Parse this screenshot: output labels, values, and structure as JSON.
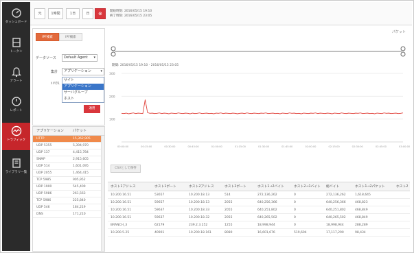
{
  "nav": {
    "items": [
      {
        "label": "ダッシュボード",
        "icon": "dashboard-icon"
      },
      {
        "label": "トークン",
        "icon": "server-icon"
      },
      {
        "label": "アラート",
        "icon": "bell-icon"
      },
      {
        "label": "レポート",
        "icon": "gauge-icon"
      },
      {
        "label": "トラフィック",
        "icon": "traffic-icon",
        "active": true
      },
      {
        "label": "ライブラリ一覧",
        "icon": "book-icon"
      }
    ]
  },
  "toolbar": {
    "buttons": [
      "元",
      "1時間",
      "1日",
      "日"
    ],
    "active_button": "⊗",
    "time_start": "開始時刻: 2016/05/15 19:10",
    "time_end": "終了時刻: 2016/05/15 23:05"
  },
  "filter": {
    "tabs": [
      "IPF検索",
      "IPF検索"
    ],
    "datasource_label": "データソース",
    "datasource_value": "Default Agent",
    "group_label": "集計",
    "group_value": "アプリケーション",
    "third_label": "ﾒﾄﾘｸｽ",
    "dropdown_options": [
      "サイト",
      "アプリケーション",
      "サーバグループ",
      "ホスト"
    ],
    "dropdown_selected": 1,
    "apply_label": "適用"
  },
  "app_table": {
    "columns": [
      "アプリケーション",
      "パケット"
    ],
    "rows": [
      [
        "HTTP",
        "15,362,905"
      ],
      [
        "UDP 5355",
        "5,394,970"
      ],
      [
        "UDP 137",
        "4,415,784"
      ],
      [
        "SNMP",
        "2,915,605"
      ],
      [
        "UDP 514",
        "1,601,095"
      ],
      [
        "UDP 2055",
        "1,464,415"
      ],
      [
        "TCP 5985",
        "905,952"
      ],
      [
        "UDP 1900",
        "545,409"
      ],
      [
        "UDP 5986",
        "261,563"
      ],
      [
        "TCP 5986",
        "225,840"
      ],
      [
        "UDP 546",
        "184,219"
      ],
      [
        "DNS",
        "171,210"
      ]
    ],
    "highlight_row": 0
  },
  "chart": {
    "right_label": "パケット",
    "range_label": "期間: 2016/05/15 19:10 - 2016/05/15 23:05",
    "export_label": "CSVとして保存"
  },
  "chart_data": {
    "type": "line",
    "title": "",
    "xlabel": "",
    "ylabel": "",
    "ylim": [
      0,
      300
    ],
    "yticks": [
      300,
      200,
      100
    ],
    "xticks": [
      "00:00:00",
      "00:15:00",
      "00:30:00",
      "00:45:00",
      "01:00:00",
      "01:15:00",
      "01:30:00",
      "01:45:00",
      "02:00:00",
      "02:15:00",
      "02:30:00",
      "02:45:00",
      "03:00:00"
    ],
    "series": [
      {
        "values": [
          125,
          124,
          126,
          123,
          125,
          127,
          124,
          126,
          125,
          124,
          185,
          128,
          125,
          126,
          124,
          125,
          127,
          124,
          126,
          125,
          123,
          126,
          125,
          124,
          127,
          125,
          124,
          126,
          125,
          123,
          126,
          124,
          125,
          127,
          124,
          125,
          126,
          124,
          125,
          123,
          126,
          125,
          127,
          124,
          126,
          125,
          124,
          126,
          125,
          123,
          125,
          126,
          124,
          127,
          125,
          124,
          126,
          125,
          124,
          126,
          125,
          127,
          124,
          125,
          126,
          124,
          125,
          123,
          126,
          125,
          124,
          127,
          125,
          126,
          124,
          125,
          123,
          126,
          125,
          124,
          126,
          125,
          127,
          124,
          126,
          125,
          124,
          126,
          125,
          123,
          126,
          125,
          124,
          127,
          125,
          124,
          126,
          125,
          124,
          126,
          125,
          127,
          124,
          125,
          126,
          124,
          125,
          123,
          126,
          125,
          124,
          127,
          125,
          126,
          124,
          125,
          126,
          124,
          125,
          127
        ]
      }
    ]
  },
  "data_table": {
    "columns": [
      "ホスト1アドレス",
      "ホスト1ポート",
      "ホスト2アドレス",
      "ホスト2ポート",
      "ホスト1→2バイト",
      "ホスト2→1バイト",
      "総バイト",
      "ホスト1→2パケット",
      "ホスト2"
    ],
    "rows": [
      [
        "10.200.16.51",
        "53657",
        "10.200.18.13",
        "514",
        "272,136,262",
        "0",
        "272,136,262",
        "1,618,645"
      ],
      [
        "10.200.16.51",
        "59657",
        "10.200.18.13",
        "2055",
        "640,256,366",
        "0",
        "640,256,366",
        "468,823"
      ],
      [
        "10.200.16.51",
        "59637",
        "10.200.18.33",
        "2055",
        "640,251,802",
        "0",
        "640,251,802",
        "468,849"
      ],
      [
        "10.200.16.51",
        "59637",
        "10.200.18.32",
        "2055",
        "640,265,502",
        "0",
        "640,265,502",
        "468,849"
      ],
      [
        "BRANCH_3",
        "62179",
        "239.2.3.252",
        "1255",
        "18,998,944",
        "0",
        "18,998,944",
        "288,289"
      ],
      [
        "10.200.5.25",
        "40901",
        "10.200.18.161",
        "8080",
        "16,601,676",
        "519,604",
        "17,117,290",
        "98,434"
      ]
    ]
  }
}
